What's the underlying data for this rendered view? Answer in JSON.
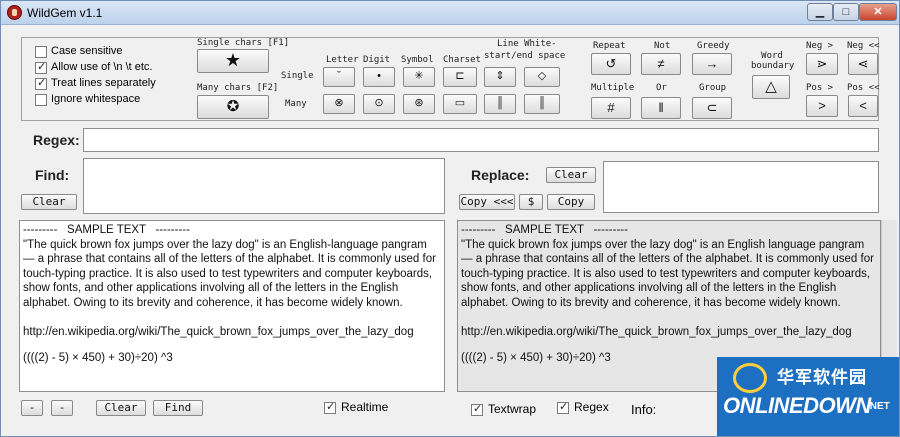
{
  "window": {
    "title": "WildGem v1.1"
  },
  "options": {
    "case_sensitive": {
      "label": "Case sensitive",
      "checked": false
    },
    "allow_escapes": {
      "label": "Allow use of \\n \\t etc.",
      "checked": true
    },
    "treat_lines": {
      "label": "Treat lines separately",
      "checked": true
    },
    "ignore_whitespace": {
      "label": "Ignore whitespace",
      "checked": false
    }
  },
  "tokens": {
    "single_chars": "Single chars [F1]",
    "many_chars": "Many chars [F2]",
    "single": "Single",
    "many": "Many",
    "letter": "Letter",
    "digit": "Digit",
    "symbol": "Symbol",
    "charset": "Charset",
    "line_white": "Line White-",
    "start_end_space": "start/end space",
    "repeat": "Repeat",
    "not": "Not",
    "greedy": "Greedy",
    "word_boundary": "Word boundary",
    "neg_right": "Neg >",
    "neg_left": "Neg <<",
    "multiple": "Multiple",
    "or": "Or",
    "group": "Group",
    "pos_right": "Pos >",
    "pos_left": "Pos <<"
  },
  "regex": {
    "label": "Regex:",
    "value": ""
  },
  "find": {
    "label": "Find:",
    "value": "",
    "clear": "Clear"
  },
  "replace": {
    "label": "Replace:",
    "value": "",
    "clear": "Clear",
    "copy_back": "Copy <<<",
    "dollar": "$",
    "copy": "Copy"
  },
  "sample": {
    "header": "---------   SAMPLE TEXT   ---------",
    "left_para": "\"The quick brown fox jumps over the lazy dog\" is an English-language pangram — a phrase that contains all of the letters of the alphabet. It is commonly used for touch-typing practice. It is also used to test typewriters and computer keyboards, show fonts, and other applications involving all of the letters in the English alphabet. Owing to its brevity and coherence, it has become widely known.",
    "right_para": "\"The quick brown fox jumps over the lazy dog\" is an English language pangram — a phrase that contains all of the letters of the alphabet. It is commonly used for touch-typing practice. It is also used to test typewriters and computer keyboards, show fonts, and other applications involving all of the letters in the English alphabet. Owing to its brevity and coherence, it has become widely known.",
    "url": "http://en.wikipedia.org/wiki/The_quick_brown_fox_jumps_over_the_lazy_dog",
    "formula": "((((2) - 5) × 450) + 30)÷20) ^3"
  },
  "bottom": {
    "minus": "-",
    "clear": "Clear",
    "find": "Find",
    "realtime": {
      "label": "Realtime",
      "checked": true
    },
    "textwrap": {
      "label": "Textwrap",
      "checked": true
    },
    "regex": {
      "label": "Regex",
      "checked": true
    },
    "info": "Info:"
  },
  "watermark": {
    "cn": "华军软件园",
    "en": "ONLINEDOWN",
    "net": ".NET"
  }
}
